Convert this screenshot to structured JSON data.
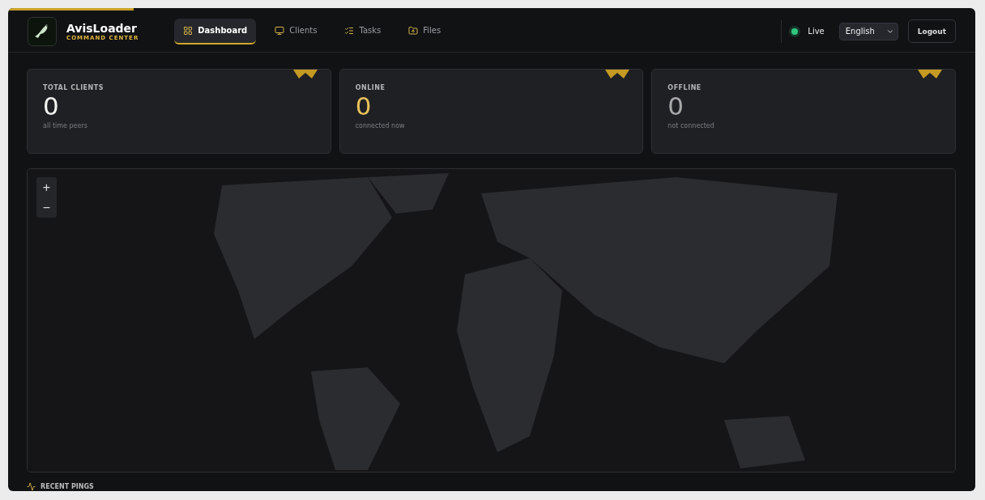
{
  "loading_bar": {
    "level": 0.13
  },
  "brand": {
    "name": "AvisLoader",
    "subtitle": "COMMAND CENTER"
  },
  "nav": [
    {
      "label": "Dashboard",
      "kind": "dashboard",
      "selected": true
    },
    {
      "label": "Clients",
      "kind": "clients",
      "selected": false
    },
    {
      "label": "Tasks",
      "kind": "tasks",
      "selected": false
    },
    {
      "label": "Files",
      "kind": "files",
      "selected": false
    }
  ],
  "status": {
    "label": "Live",
    "on": true
  },
  "language": {
    "value": "English"
  },
  "logout": "Logout",
  "stats": [
    {
      "title": "TOTAL CLIENTS",
      "value": "0",
      "caption": "all time peers",
      "color": "#f4f4f2"
    },
    {
      "title": "ONLINE",
      "value": "0",
      "caption": "connected now",
      "color": "#e8c15a"
    },
    {
      "title": "OFFLINE",
      "value": "0",
      "caption": "not connected",
      "color": "#a9a9a9"
    }
  ],
  "map": {
    "zoom_in": "+",
    "zoom_out": "−"
  },
  "recent": {
    "title": "RECENT PINGS"
  }
}
